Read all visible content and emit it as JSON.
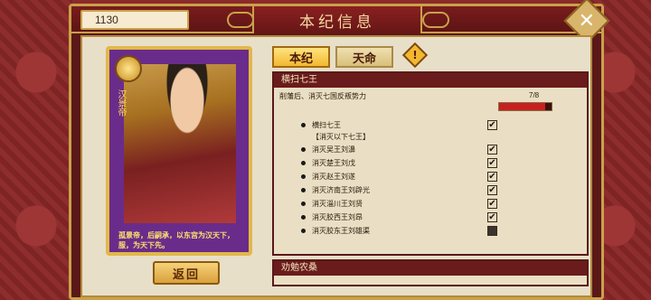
{
  "header": {
    "title": "本纪信息",
    "coins": "1130",
    "close_icon": "close-icon"
  },
  "card": {
    "name": "汉景帝",
    "quote": "孤景帝，后嗣承，以东宫为汉天下，服，为天下先。"
  },
  "buttons": {
    "back": "返回"
  },
  "tabs": [
    {
      "label": "本纪",
      "active": true
    },
    {
      "label": "天命",
      "active": false
    }
  ],
  "quest": {
    "title": "横扫七王",
    "description": "削藩后、消灭七国反叛势力",
    "progress_text": "7/8",
    "progress_fraction": 0.875,
    "objectives": [
      {
        "label": "横扫七王",
        "done": true,
        "sub": false
      },
      {
        "label": "【消灭以下七王】",
        "done": null,
        "sub": true
      },
      {
        "label": "消灭吴王刘濞",
        "done": true,
        "sub": false
      },
      {
        "label": "消灭楚王刘戊",
        "done": true,
        "sub": false
      },
      {
        "label": "消灭赵王刘遂",
        "done": true,
        "sub": false
      },
      {
        "label": "消灭济南王刘辟光",
        "done": true,
        "sub": false
      },
      {
        "label": "消灭淄川王刘贤",
        "done": true,
        "sub": false
      },
      {
        "label": "消灭胶西王刘昂",
        "done": true,
        "sub": false
      },
      {
        "label": "消灭胶东王刘雄渠",
        "done": false,
        "sub": false
      }
    ]
  },
  "quest2": {
    "title": "劝勉农桑"
  },
  "colors": {
    "accent": "#c9a14a",
    "frame": "#5a1818",
    "progress": "#c42222"
  }
}
